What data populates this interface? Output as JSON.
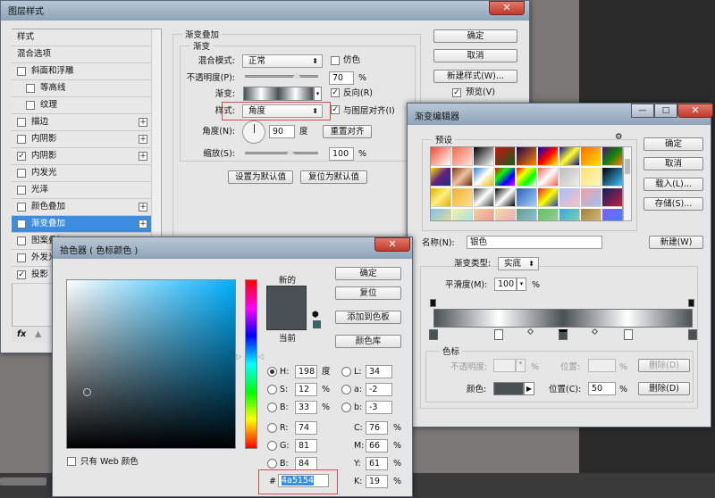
{
  "layer_style": {
    "title": "图层样式",
    "list": [
      {
        "label": "样式",
        "checkbox": null,
        "plus": false,
        "indent": false
      },
      {
        "label": "混合选项",
        "checkbox": null,
        "plus": false,
        "indent": false
      },
      {
        "label": "斜面和浮雕",
        "checkbox": false,
        "plus": false,
        "indent": false
      },
      {
        "label": "等高线",
        "checkbox": false,
        "plus": false,
        "indent": true
      },
      {
        "label": "纹理",
        "checkbox": false,
        "plus": false,
        "indent": true
      },
      {
        "label": "描边",
        "checkbox": false,
        "plus": true,
        "indent": false
      },
      {
        "label": "内阴影",
        "checkbox": false,
        "plus": true,
        "indent": false
      },
      {
        "label": "内阴影",
        "checkbox": true,
        "plus": true,
        "indent": false
      },
      {
        "label": "内发光",
        "checkbox": false,
        "plus": false,
        "indent": false
      },
      {
        "label": "光泽",
        "checkbox": false,
        "plus": false,
        "indent": false
      },
      {
        "label": "颜色叠加",
        "checkbox": false,
        "plus": true,
        "indent": false
      },
      {
        "label": "渐变叠加",
        "checkbox": true,
        "plus": true,
        "indent": false,
        "selected": true
      },
      {
        "label": "图案叠加",
        "checkbox": false,
        "plus": false,
        "indent": false
      },
      {
        "label": "外发光",
        "checkbox": false,
        "plus": false,
        "indent": false
      },
      {
        "label": "投影",
        "checkbox": true,
        "plus": false,
        "indent": false
      }
    ],
    "fx_label": "fx",
    "section_title": "渐变叠加",
    "group_title": "渐变",
    "blend_mode_label": "混合模式:",
    "blend_mode": "正常",
    "dither_label": "仿色",
    "opacity_label": "不透明度(P):",
    "opacity": "70",
    "percent": "%",
    "gradient_label": "渐变:",
    "reverse_label": "反向(R)",
    "style_label": "样式:",
    "style": "角度",
    "align_label": "与图层对齐(I)",
    "angle_label": "角度(N):",
    "angle": "90",
    "degree": "度",
    "reset_align": "重置对齐",
    "scale_label": "缩放(S):",
    "scale": "100",
    "set_default": "设置为默认值",
    "reset_default": "复位为默认值",
    "ok": "确定",
    "cancel": "取消",
    "new_style": "新建样式(W)...",
    "preview": "预览(V)"
  },
  "gradient_editor": {
    "title": "渐变编辑器",
    "presets_label": "预设",
    "ok": "确定",
    "cancel": "取消",
    "load": "载入(L)...",
    "save": "存储(S)...",
    "name_label": "名称(N):",
    "name": "银色",
    "new": "新建(W)",
    "type_label": "渐变类型:",
    "type": "实底",
    "smooth_label": "平滑度(M):",
    "smooth": "100",
    "percent": "%",
    "stops_group": "色标",
    "opacity_label": "不透明度:",
    "location_label": "位置:",
    "delete": "删除(D)",
    "color_label": "颜色:",
    "color_location_label": "位置(C):",
    "color_location": "50",
    "stop_color": "#4a5154",
    "color_stops": [
      0,
      25,
      50,
      75,
      100
    ],
    "presets": [
      [
        "#f04a30",
        "#ffffff"
      ],
      [
        "#f06a50",
        "#ffe0d8"
      ],
      [
        "#000000",
        "#ffffff"
      ],
      [
        "#d01010",
        "#106020"
      ],
      [
        "#200050",
        "#ff8800"
      ],
      [
        "#0000c0",
        "#ff0000",
        "#ffff00"
      ],
      [
        "#101090",
        "#ffff30",
        "#101090"
      ],
      [
        "#ff6a00",
        "#ffe000"
      ],
      [
        "#501070",
        "#108010",
        "#ff8000"
      ],
      [
        "#ffdd00",
        "#602080",
        "#203080"
      ],
      [
        "#7a3a10",
        "#f0c0a0",
        "#603010"
      ],
      [
        "#3080d0",
        "#ffffff",
        "#e0c000"
      ],
      [
        "#ff0000",
        "#00ff00",
        "#0000ff",
        "#ff00ff"
      ],
      [
        "#ff0000",
        "#ffff00",
        "#00ff00",
        "#ffffff"
      ],
      [
        "#f06050",
        "#ffffff",
        "#f06050"
      ],
      [
        "#bbbbbb",
        "#eeeeee"
      ],
      [
        "#ffe070",
        "#fff8c0"
      ],
      [
        "#000000",
        "#40c0ff"
      ],
      [
        "#e0b000",
        "#fff080",
        "#e0b000"
      ],
      [
        "#f0b030",
        "#ffe090"
      ],
      [
        "#404040",
        "#ffffff",
        "#404040"
      ],
      [
        "#000000",
        "#ffffff",
        "#000000"
      ],
      [
        "#3060b0",
        "#a0d0ff"
      ],
      [
        "#e02020",
        "#ffff00",
        "#2040c0"
      ],
      [
        "#a0c0ff",
        "#ffc0c0"
      ],
      [
        "#f0a0a0",
        "#a0c0f0"
      ],
      [
        "#102060",
        "#c02040"
      ],
      [
        "#80c0f0",
        "#f0e080"
      ],
      [
        "#f0f0a0",
        "#a0e0f0"
      ],
      [
        "#f0d0a0",
        "#f09090"
      ],
      [
        "#f0e0a0",
        "#f0a0c0"
      ],
      [
        "#60a080",
        "#a0c0f0"
      ],
      [
        "#60c060",
        "#a0d0a0"
      ],
      [
        "#40a0e0",
        "#80e0a0"
      ],
      [
        "#a08040",
        "#e0c080"
      ],
      [
        "#8060f0",
        "#4080ff"
      ]
    ]
  },
  "color_picker": {
    "title": "拾色器 ( 色标颜色 )",
    "new_label": "新的",
    "current_label": "当前",
    "new_color": "#4a5154",
    "current_color": "#4a5154",
    "ok": "确定",
    "reset": "复位",
    "add_swatch": "添加到色板",
    "color_libraries": "颜色库",
    "web_only": "只有 Web 颜色",
    "hsb": [
      {
        "label": "H:",
        "value": "198",
        "unit": "度",
        "selected": true
      },
      {
        "label": "S:",
        "value": "12",
        "unit": "%"
      },
      {
        "label": "B:",
        "value": "33",
        "unit": "%"
      }
    ],
    "rgb": [
      {
        "label": "R:",
        "value": "74"
      },
      {
        "label": "G:",
        "value": "81"
      },
      {
        "label": "B:",
        "value": "84"
      }
    ],
    "lab": [
      {
        "label": "L:",
        "value": "34"
      },
      {
        "label": "a:",
        "value": "-2"
      },
      {
        "label": "b:",
        "value": "-3"
      }
    ],
    "cmyk": [
      {
        "label": "C:",
        "value": "76"
      },
      {
        "label": "M:",
        "value": "66"
      },
      {
        "label": "Y:",
        "value": "61"
      },
      {
        "label": "K:",
        "value": "19"
      }
    ],
    "percent": "%",
    "hash": "#",
    "hex": "4a5154",
    "field_hue": "#00b0ff"
  }
}
